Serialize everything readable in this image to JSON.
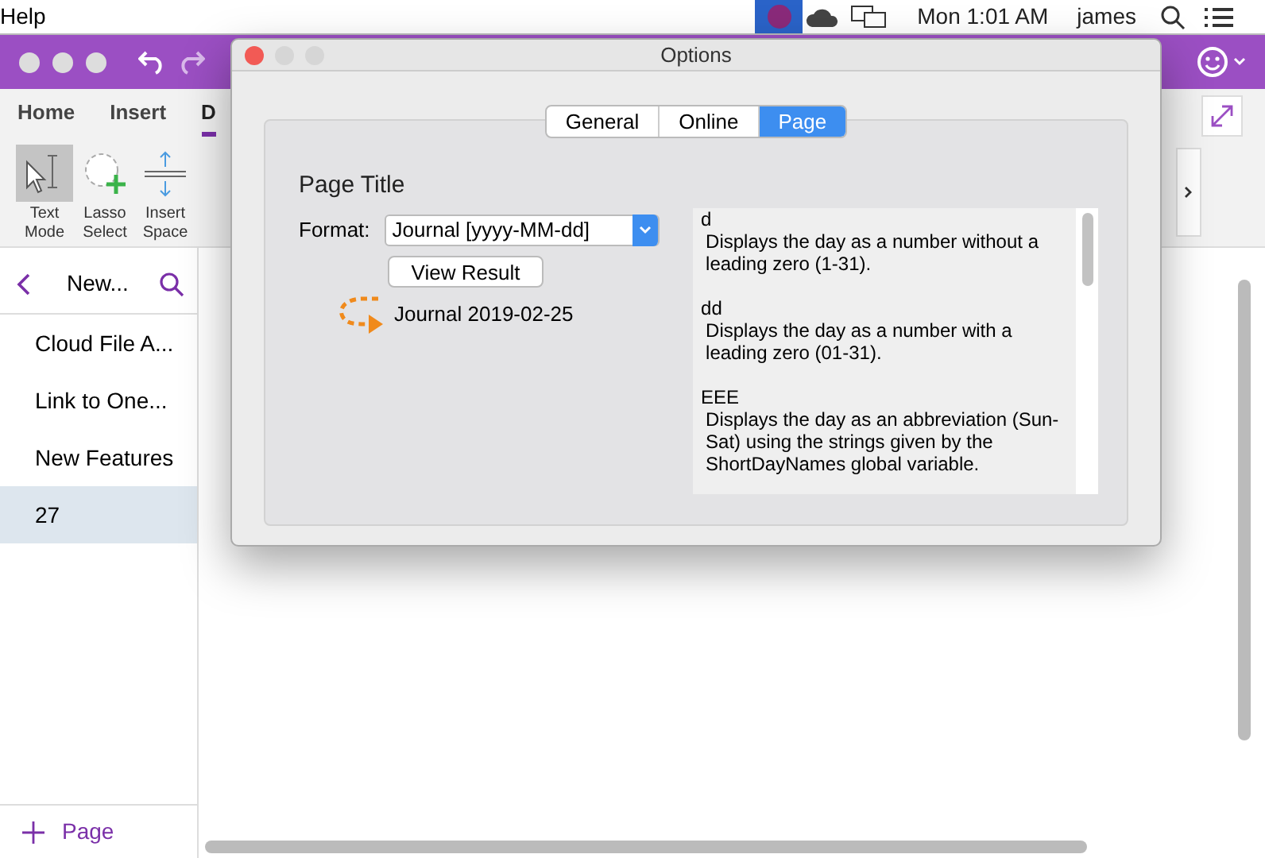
{
  "menu_bar": {
    "menu": "Help",
    "clock": "Mon 1:01 AM",
    "user": "james"
  },
  "ribbon_tabs": [
    {
      "label": "Home",
      "selected": false
    },
    {
      "label": "Insert",
      "selected": false
    },
    {
      "label": "D",
      "selected": true
    }
  ],
  "tools": [
    {
      "kind": "text-mode",
      "label": "Text Mode",
      "selected": true
    },
    {
      "kind": "lasso",
      "label": "Lasso Select",
      "selected": false
    },
    {
      "kind": "insert-space",
      "label": "Insert Space",
      "selected": false
    }
  ],
  "section_header": {
    "title": "New..."
  },
  "pages": [
    {
      "label": "Cloud File A...",
      "selected": false
    },
    {
      "label": "Link to One...",
      "selected": false
    },
    {
      "label": "New Features",
      "selected": false
    },
    {
      "label": "27",
      "selected": true
    }
  ],
  "add_page": "Page",
  "dialog": {
    "title": "Options",
    "tabs": [
      {
        "label": "General",
        "selected": false
      },
      {
        "label": "Online",
        "selected": false
      },
      {
        "label": "Page",
        "selected": true
      }
    ],
    "heading": "Page Title",
    "format_label": "Format:",
    "format_value": "Journal [yyyy-MM-dd]",
    "view_button": "View Result",
    "result": "Journal 2019-02-25",
    "help": [
      {
        "term": "d",
        "description": "Displays the day as a number without a leading zero (1-31)."
      },
      {
        "term": "dd",
        "description": "Displays the day as a number with a leading zero (01-31)."
      },
      {
        "term": "EEE",
        "description": "Displays the day as an abbreviation (Sun-Sat) using the strings given by the ShortDayNames global variable."
      }
    ]
  }
}
